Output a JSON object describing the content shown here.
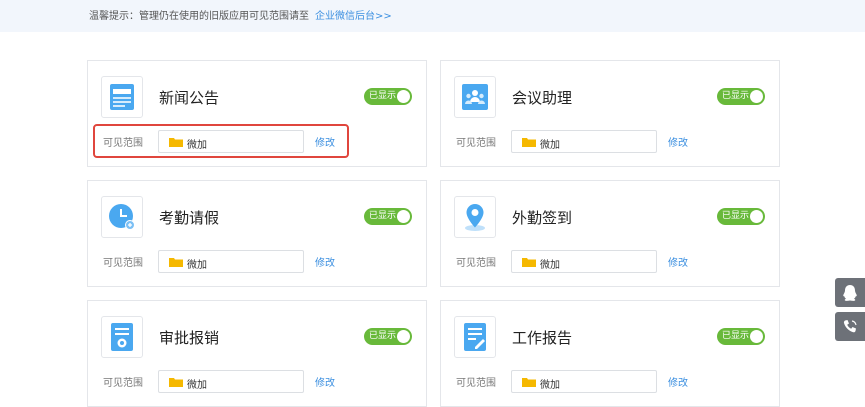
{
  "notice": {
    "text": "温馨提示：管理仍在使用的旧版应用可见范围请至",
    "link": "企业微信后台>>"
  },
  "cards": [
    {
      "name": "新闻公告",
      "icon": "news-icon",
      "toggle": "已显示",
      "vis_label": "可见范围",
      "vis_value": "微加",
      "edit": "修改"
    },
    {
      "name": "会议助理",
      "icon": "meeting-icon",
      "toggle": "已显示",
      "vis_label": "可见范围",
      "vis_value": "微加",
      "edit": "修改"
    },
    {
      "name": "考勤请假",
      "icon": "clock-icon",
      "toggle": "已显示",
      "vis_label": "可见范围",
      "vis_value": "微加",
      "edit": "修改"
    },
    {
      "name": "外勤签到",
      "icon": "location-pin-icon",
      "toggle": "已显示",
      "vis_label": "可见范围",
      "vis_value": "微加",
      "edit": "修改"
    },
    {
      "name": "审批报销",
      "icon": "approval-doc-icon",
      "toggle": "已显示",
      "vis_label": "可见范围",
      "vis_value": "微加",
      "edit": "修改"
    },
    {
      "name": "工作报告",
      "icon": "report-doc-icon",
      "toggle": "已显示",
      "vis_label": "可见范围",
      "vis_value": "微加",
      "edit": "修改"
    }
  ],
  "side": {
    "icons": [
      "qq-icon",
      "phone-icon"
    ]
  },
  "colors": {
    "accent": "#3b8fe0",
    "toggle_on": "#68b93a",
    "highlight": "#e0463d",
    "icon_blue": "#4aa8f0"
  }
}
